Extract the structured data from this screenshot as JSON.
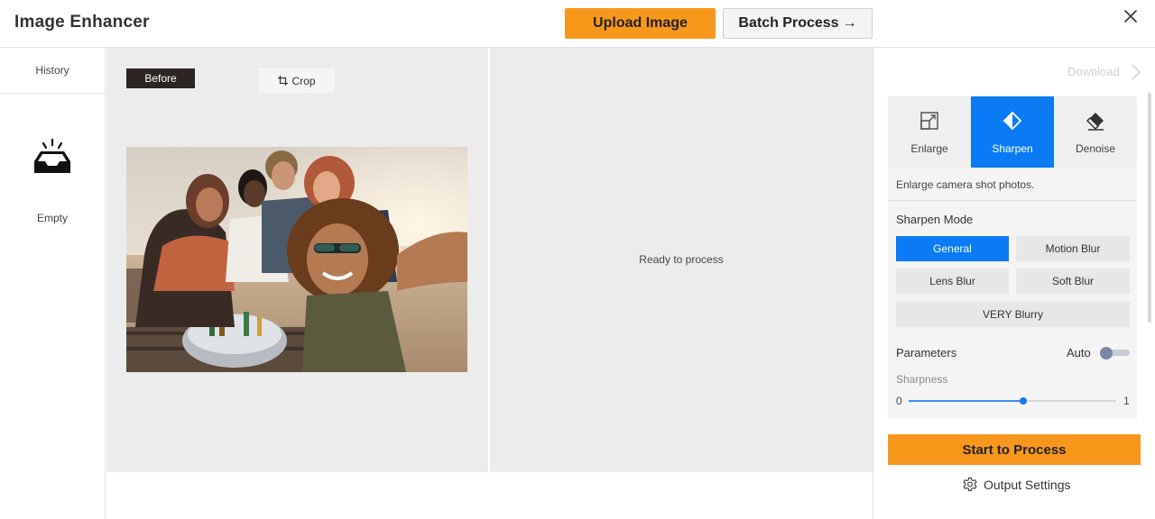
{
  "header": {
    "title": "Image Enhancer",
    "upload_label": "Upload Image",
    "batch_label": "Batch Process",
    "batch_arrow": "→"
  },
  "sidebar": {
    "history_label": "History",
    "empty_label": "Empty"
  },
  "canvas": {
    "before_label": "Before",
    "crop_label": "Crop",
    "ready_text": "Ready to process"
  },
  "panel": {
    "download_label": "Download",
    "tabs": [
      {
        "label": "Enlarge",
        "icon": "enlarge-icon",
        "active": false
      },
      {
        "label": "Sharpen",
        "icon": "sharpen-icon",
        "active": true
      },
      {
        "label": "Denoise",
        "icon": "eraser-icon",
        "active": false
      }
    ],
    "description": "Enlarge camera shot photos.",
    "mode_title": "Sharpen Mode",
    "modes": [
      {
        "label": "General",
        "active": true
      },
      {
        "label": "Motion Blur",
        "active": false
      },
      {
        "label": "Lens Blur",
        "active": false
      },
      {
        "label": "Soft Blur",
        "active": false
      },
      {
        "label": "VERY Blurry",
        "active": false
      }
    ],
    "params_title": "Parameters",
    "auto_label": "Auto",
    "auto_on": false,
    "sharpness_label": "Sharpness",
    "sharpness_min": "0",
    "sharpness_max": "1",
    "sharpness_value": 0.55,
    "start_label": "Start to Process",
    "output_settings_label": "Output Settings"
  },
  "colors": {
    "accent_orange": "#f7981d",
    "accent_blue": "#0a7bf5"
  }
}
